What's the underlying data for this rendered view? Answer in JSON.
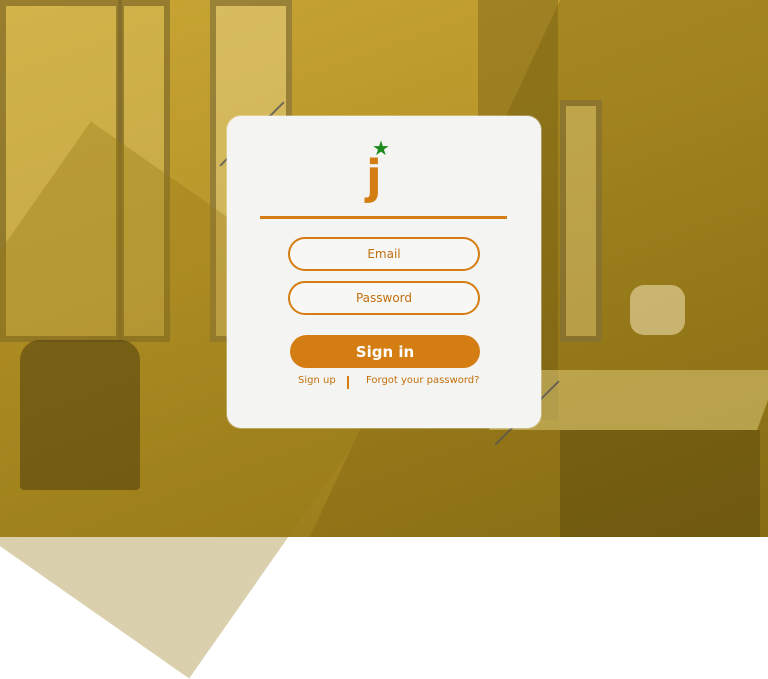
{
  "brand": {
    "logo_letter": "j",
    "logo_star": "★",
    "accent": "#d47d12",
    "star_color": "#1c8a1c"
  },
  "form": {
    "email_placeholder": "Email",
    "password_placeholder": "Password",
    "submit_label": "Sign in"
  },
  "links": {
    "signup": "Sign up",
    "forgot": "Forgot your password?"
  }
}
